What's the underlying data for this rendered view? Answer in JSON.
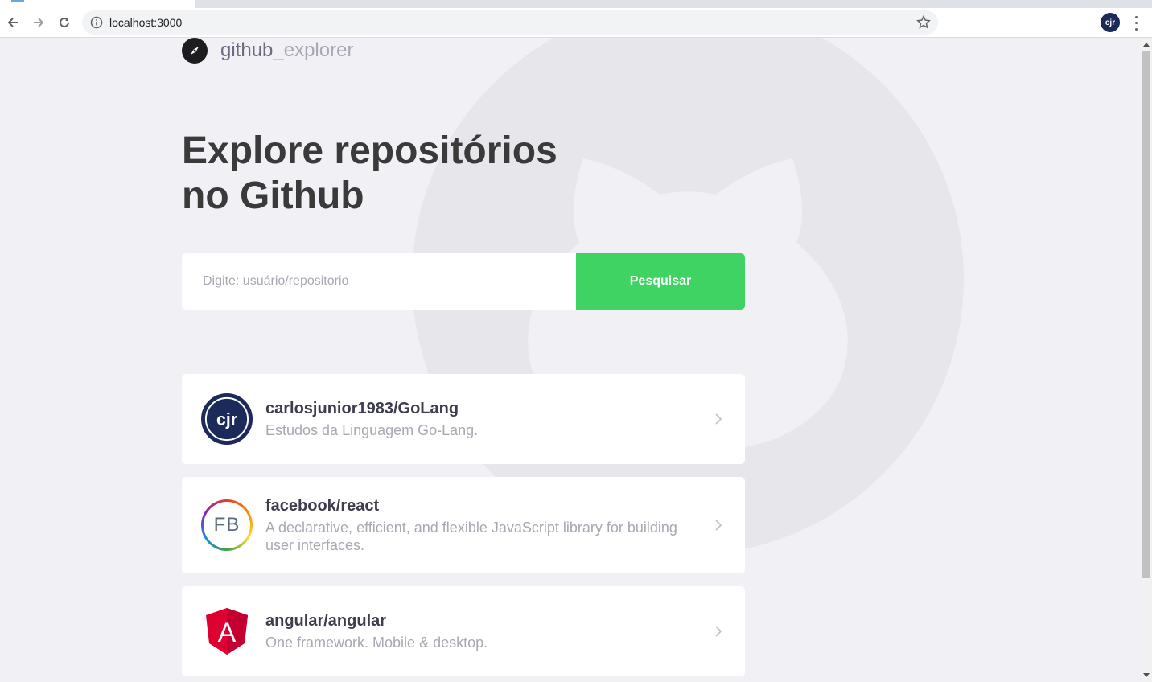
{
  "browser": {
    "url": "localhost:3000",
    "profile_initials": "cjr"
  },
  "header": {
    "logo_prefix": "github",
    "logo_suffix": "_explorer"
  },
  "hero": {
    "title_line1": "Explore repositórios",
    "title_line2": "no Github"
  },
  "search": {
    "placeholder": "Digite: usuário/repositorio",
    "button_label": "Pesquisar"
  },
  "repositories": [
    {
      "name": "carlosjunior1983/GoLang",
      "description": "Estudos da Linguagem Go-Lang.",
      "avatar_text": "cjr"
    },
    {
      "name": "facebook/react",
      "description": "A declarative, efficient, and flexible JavaScript library for building user interfaces.",
      "avatar_text": "FB"
    },
    {
      "name": "angular/angular",
      "description": "One framework. Mobile & desktop.",
      "avatar_text": "A"
    }
  ],
  "colors": {
    "accent": "#3ed362",
    "background": "#f0f0f5",
    "title": "#3a3a3a",
    "muted": "#a8a8b3"
  }
}
